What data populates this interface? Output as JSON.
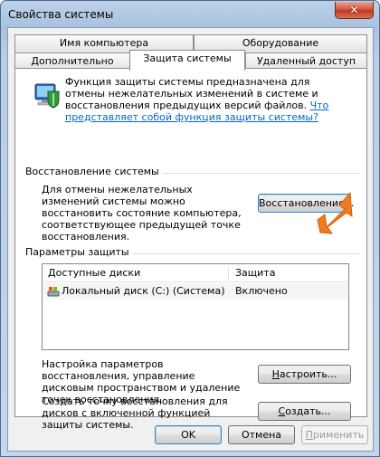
{
  "window": {
    "title": "Свойства системы",
    "close_label": "✕"
  },
  "tabs": {
    "row1": [
      {
        "label": "Имя компьютера"
      },
      {
        "label": "Оборудование"
      }
    ],
    "row2": [
      {
        "label": "Дополнительно"
      },
      {
        "label": "Защита системы"
      },
      {
        "label": "Удаленный доступ"
      }
    ]
  },
  "intro": {
    "text": "Функция защиты системы предназначена для отмены нежелательных изменений в системе и восстановления предыдущих версий файлов. ",
    "link": "Что представляет собой функция защиты системы?",
    "icon": "system-protection-shield-icon"
  },
  "restore_section": {
    "title": "Восстановление системы",
    "description": "Для отмены нежелательных изменений системы можно восстановить состояние компьютера, соответствующее предыдущей точке восстановления.",
    "button": "Восстановление..."
  },
  "protection_section": {
    "title": "Параметры защиты",
    "columns": [
      "Доступные диски",
      "Защита"
    ],
    "rows": [
      {
        "drive": "Локальный диск (C:) (Система)",
        "status": "Включено",
        "icon": "local-disk-icon"
      }
    ]
  },
  "configure": {
    "description": "Настройка параметров восстановления, управление дисковым пространством и удаление точек восстановления.",
    "button_prefix": "Н",
    "button_rest": "астроить..."
  },
  "create": {
    "description": "Создать точку восстановления для дисков с включенной функцией защиты системы.",
    "button_prefix": "С",
    "button_rest": "оздать..."
  },
  "footer": {
    "ok": "OK",
    "cancel": "Отмена",
    "apply_prefix": "П",
    "apply_rest": "рименить"
  },
  "colors": {
    "accent_arrow": "#f07c1f",
    "link": "#0066cc"
  }
}
